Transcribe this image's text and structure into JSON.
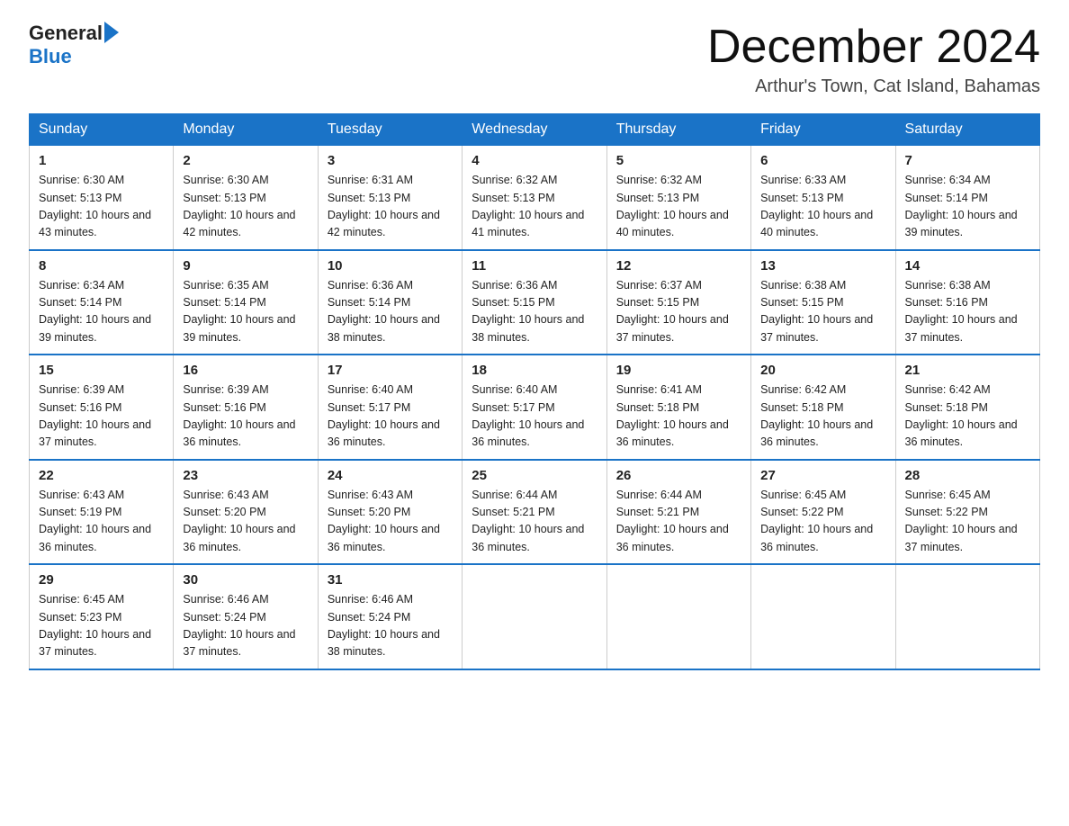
{
  "logo": {
    "text_general": "General",
    "text_blue": "Blue"
  },
  "header": {
    "title": "December 2024",
    "subtitle": "Arthur's Town, Cat Island, Bahamas"
  },
  "days_of_week": [
    "Sunday",
    "Monday",
    "Tuesday",
    "Wednesday",
    "Thursday",
    "Friday",
    "Saturday"
  ],
  "weeks": [
    [
      {
        "day": "1",
        "sunrise": "6:30 AM",
        "sunset": "5:13 PM",
        "daylight": "10 hours and 43 minutes."
      },
      {
        "day": "2",
        "sunrise": "6:30 AM",
        "sunset": "5:13 PM",
        "daylight": "10 hours and 42 minutes."
      },
      {
        "day": "3",
        "sunrise": "6:31 AM",
        "sunset": "5:13 PM",
        "daylight": "10 hours and 42 minutes."
      },
      {
        "day": "4",
        "sunrise": "6:32 AM",
        "sunset": "5:13 PM",
        "daylight": "10 hours and 41 minutes."
      },
      {
        "day": "5",
        "sunrise": "6:32 AM",
        "sunset": "5:13 PM",
        "daylight": "10 hours and 40 minutes."
      },
      {
        "day": "6",
        "sunrise": "6:33 AM",
        "sunset": "5:13 PM",
        "daylight": "10 hours and 40 minutes."
      },
      {
        "day": "7",
        "sunrise": "6:34 AM",
        "sunset": "5:14 PM",
        "daylight": "10 hours and 39 minutes."
      }
    ],
    [
      {
        "day": "8",
        "sunrise": "6:34 AM",
        "sunset": "5:14 PM",
        "daylight": "10 hours and 39 minutes."
      },
      {
        "day": "9",
        "sunrise": "6:35 AM",
        "sunset": "5:14 PM",
        "daylight": "10 hours and 39 minutes."
      },
      {
        "day": "10",
        "sunrise": "6:36 AM",
        "sunset": "5:14 PM",
        "daylight": "10 hours and 38 minutes."
      },
      {
        "day": "11",
        "sunrise": "6:36 AM",
        "sunset": "5:15 PM",
        "daylight": "10 hours and 38 minutes."
      },
      {
        "day": "12",
        "sunrise": "6:37 AM",
        "sunset": "5:15 PM",
        "daylight": "10 hours and 37 minutes."
      },
      {
        "day": "13",
        "sunrise": "6:38 AM",
        "sunset": "5:15 PM",
        "daylight": "10 hours and 37 minutes."
      },
      {
        "day": "14",
        "sunrise": "6:38 AM",
        "sunset": "5:16 PM",
        "daylight": "10 hours and 37 minutes."
      }
    ],
    [
      {
        "day": "15",
        "sunrise": "6:39 AM",
        "sunset": "5:16 PM",
        "daylight": "10 hours and 37 minutes."
      },
      {
        "day": "16",
        "sunrise": "6:39 AM",
        "sunset": "5:16 PM",
        "daylight": "10 hours and 36 minutes."
      },
      {
        "day": "17",
        "sunrise": "6:40 AM",
        "sunset": "5:17 PM",
        "daylight": "10 hours and 36 minutes."
      },
      {
        "day": "18",
        "sunrise": "6:40 AM",
        "sunset": "5:17 PM",
        "daylight": "10 hours and 36 minutes."
      },
      {
        "day": "19",
        "sunrise": "6:41 AM",
        "sunset": "5:18 PM",
        "daylight": "10 hours and 36 minutes."
      },
      {
        "day": "20",
        "sunrise": "6:42 AM",
        "sunset": "5:18 PM",
        "daylight": "10 hours and 36 minutes."
      },
      {
        "day": "21",
        "sunrise": "6:42 AM",
        "sunset": "5:18 PM",
        "daylight": "10 hours and 36 minutes."
      }
    ],
    [
      {
        "day": "22",
        "sunrise": "6:43 AM",
        "sunset": "5:19 PM",
        "daylight": "10 hours and 36 minutes."
      },
      {
        "day": "23",
        "sunrise": "6:43 AM",
        "sunset": "5:20 PM",
        "daylight": "10 hours and 36 minutes."
      },
      {
        "day": "24",
        "sunrise": "6:43 AM",
        "sunset": "5:20 PM",
        "daylight": "10 hours and 36 minutes."
      },
      {
        "day": "25",
        "sunrise": "6:44 AM",
        "sunset": "5:21 PM",
        "daylight": "10 hours and 36 minutes."
      },
      {
        "day": "26",
        "sunrise": "6:44 AM",
        "sunset": "5:21 PM",
        "daylight": "10 hours and 36 minutes."
      },
      {
        "day": "27",
        "sunrise": "6:45 AM",
        "sunset": "5:22 PM",
        "daylight": "10 hours and 36 minutes."
      },
      {
        "day": "28",
        "sunrise": "6:45 AM",
        "sunset": "5:22 PM",
        "daylight": "10 hours and 37 minutes."
      }
    ],
    [
      {
        "day": "29",
        "sunrise": "6:45 AM",
        "sunset": "5:23 PM",
        "daylight": "10 hours and 37 minutes."
      },
      {
        "day": "30",
        "sunrise": "6:46 AM",
        "sunset": "5:24 PM",
        "daylight": "10 hours and 37 minutes."
      },
      {
        "day": "31",
        "sunrise": "6:46 AM",
        "sunset": "5:24 PM",
        "daylight": "10 hours and 38 minutes."
      },
      null,
      null,
      null,
      null
    ]
  ]
}
